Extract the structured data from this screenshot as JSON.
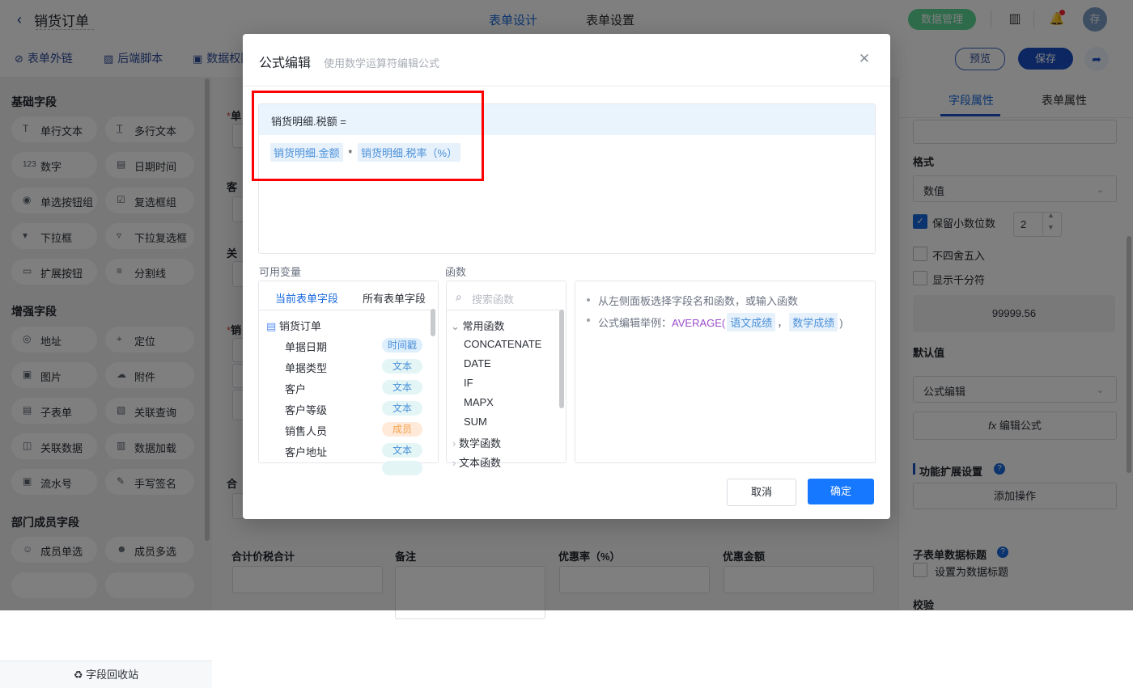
{
  "header": {
    "back_icon": "‹",
    "title": "销货订单",
    "tabs": [
      {
        "label": "表单设计"
      },
      {
        "label": "表单设置"
      }
    ],
    "data_manage_label": "数据管理",
    "contact_icon": "▥",
    "bell_icon": "🔔",
    "avatar_text": "存"
  },
  "toolbar": {
    "items": [
      {
        "glyph": "⊘",
        "label": "表单外链"
      },
      {
        "glyph": "▨",
        "label": "后端脚本"
      },
      {
        "glyph": "▣",
        "label": "数据权限"
      }
    ],
    "preview_label": "预览",
    "save_label": "保存",
    "share_icon": "➦"
  },
  "sidebar": {
    "groups": [
      {
        "title": "基础字段",
        "fields": [
          {
            "glyph": "T",
            "label": "单行文本"
          },
          {
            "glyph": "T̲",
            "label": "多行文本"
          },
          {
            "glyph": "123",
            "label": "数字"
          },
          {
            "glyph": "▤",
            "label": "日期时间"
          },
          {
            "glyph": "◉",
            "label": "单选按钮组"
          },
          {
            "glyph": "☑",
            "label": "复选框组"
          },
          {
            "glyph": "▾",
            "label": "下拉框"
          },
          {
            "glyph": "▿",
            "label": "下拉复选框"
          },
          {
            "glyph": "▭",
            "label": "扩展按钮"
          },
          {
            "glyph": "≡",
            "label": "分割线"
          }
        ]
      },
      {
        "title": "增强字段",
        "fields": [
          {
            "glyph": "◎",
            "label": "地址"
          },
          {
            "glyph": "⌖",
            "label": "定位"
          },
          {
            "glyph": "▣",
            "label": "图片"
          },
          {
            "glyph": "☁",
            "label": "附件"
          },
          {
            "glyph": "▤",
            "label": "子表单"
          },
          {
            "glyph": "▧",
            "label": "关联查询"
          },
          {
            "glyph": "◫",
            "label": "关联数据"
          },
          {
            "glyph": "▥",
            "label": "数据加载"
          },
          {
            "glyph": "▣",
            "label": "流水号"
          },
          {
            "glyph": "✎",
            "label": "手写签名"
          }
        ]
      },
      {
        "title": "部门成员字段",
        "fields": [
          {
            "glyph": "☺",
            "label": "成员单选"
          },
          {
            "glyph": "☻",
            "label": "成员多选"
          }
        ]
      }
    ],
    "recycle": {
      "glyph": "♻",
      "label": "字段回收站"
    }
  },
  "form": {
    "clipped_labels": [
      {
        "req": "*",
        "text": "单"
      },
      {
        "req": "",
        "text": "客"
      },
      {
        "req": "",
        "text": "关"
      },
      {
        "req": "*",
        "text": "销"
      },
      {
        "req": "",
        "text": "合"
      }
    ],
    "bottom_fields": [
      {
        "label": "合计价税合计"
      },
      {
        "label": "备注"
      },
      {
        "label": "优惠率（%）"
      },
      {
        "label": "优惠金额"
      }
    ]
  },
  "right_panel": {
    "tabs": [
      {
        "label": "字段属性"
      },
      {
        "label": "表单属性"
      }
    ],
    "format_label": "格式",
    "format_value": "数值",
    "decimal_checkbox": {
      "label": "保留小数位数",
      "checked": true,
      "value": "2"
    },
    "no_round_checkbox": {
      "label": "不四舍五入",
      "checked": false
    },
    "thousand_checkbox": {
      "label": "显示千分符",
      "checked": false
    },
    "preview_value": "99999.56",
    "default_label": "默认值",
    "default_value": "公式编辑",
    "edit_formula_button": {
      "glyph": "fx",
      "label": "编辑公式"
    },
    "extension_section": {
      "label": "功能扩展设置",
      "help": "?"
    },
    "add_action_button": "添加操作",
    "subform_title_section": {
      "label": "子表单数据标题",
      "help": "?"
    },
    "subform_title_checkbox": {
      "label": "设置为数据标题",
      "checked": false
    },
    "validate_label": "校验"
  },
  "modal": {
    "title": "公式编辑",
    "subtitle": "使用数学运算符编辑公式",
    "close_icon": "✕",
    "formula_target": "销货明细.税额 =",
    "formula_parts": [
      {
        "type": "variable",
        "text": "销货明细.金额"
      },
      {
        "type": "operator",
        "text": "*"
      },
      {
        "type": "variable",
        "text": "销货明细.税率（%）"
      }
    ],
    "variables_panel": {
      "label": "可用变量",
      "tabs": [
        {
          "label": "当前表单字段"
        },
        {
          "label": "所有表单字段"
        }
      ],
      "root": {
        "glyph": "▤",
        "label": "销货订单"
      },
      "rows": [
        {
          "label": "单据日期",
          "tag": "时间戳",
          "tag_type": "ts"
        },
        {
          "label": "单据类型",
          "tag": "文本",
          "tag_type": "txt"
        },
        {
          "label": "客户",
          "tag": "文本",
          "tag_type": "txt"
        },
        {
          "label": "客户等级",
          "tag": "文本",
          "tag_type": "txt"
        },
        {
          "label": "销售人员",
          "tag": "成员",
          "tag_type": "mem"
        },
        {
          "label": "客户地址",
          "tag": "文本",
          "tag_type": "txt"
        }
      ]
    },
    "functions_panel": {
      "label": "函数",
      "search_placeholder": "搜索函数",
      "search_icon": "⌕",
      "groups": [
        {
          "expanded": true,
          "caret": "⌄",
          "label": "常用函数"
        },
        {
          "expanded": false,
          "caret": "›",
          "label": "数学函数"
        },
        {
          "expanded": false,
          "caret": "›",
          "label": "文本函数"
        }
      ],
      "items": [
        "CONCATENATE",
        "DATE",
        "IF",
        "MAPX",
        "SUM"
      ]
    },
    "help_panel": {
      "tip1": "从左侧面板选择字段名和函数，或输入函数",
      "tip2_prefix": "公式编辑举例：",
      "tip2_function": "AVERAGE(",
      "tip2_arg1": "语文成绩",
      "tip2_comma": "，",
      "tip2_arg2": "数学成绩",
      "tip2_suffix": ")"
    },
    "cancel_label": "取消",
    "confirm_label": "确定"
  }
}
